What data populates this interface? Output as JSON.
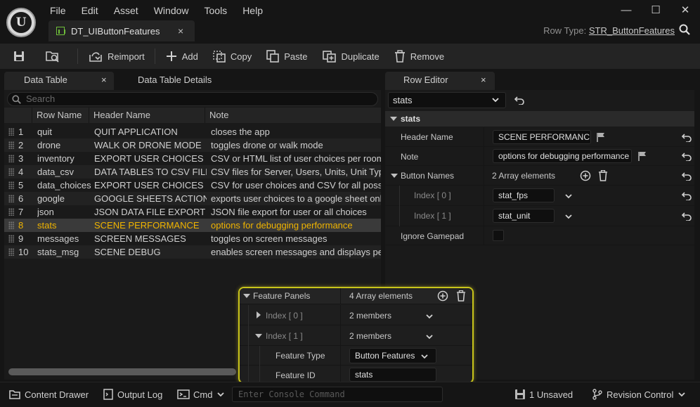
{
  "app": {
    "logo_letter": "U",
    "menu": [
      "File",
      "Edit",
      "Asset",
      "Window",
      "Tools",
      "Help"
    ],
    "window_controls": [
      "―",
      "☐",
      "✕"
    ],
    "document_tab": "DT_UIButtonFeatures",
    "document_tab_close": "×",
    "row_type_label": "Row Type:",
    "row_type_value": "STR_ButtonFeatures"
  },
  "toolbar": {
    "reimport": "Reimport",
    "add": "Add",
    "copy": "Copy",
    "paste": "Paste",
    "duplicate": "Duplicate",
    "remove": "Remove"
  },
  "left_panel": {
    "tab_data_table": "Data Table",
    "tab_close": "×",
    "tab_details": "Data Table Details",
    "search_placeholder": "Search",
    "columns": [
      "Row Name",
      "Header Name",
      "Note"
    ],
    "rows": [
      {
        "num": "1",
        "name": "quit",
        "header": "QUIT APPLICATION",
        "note": "closes the app"
      },
      {
        "num": "2",
        "name": "drone",
        "header": "WALK OR DRONE MODE",
        "note": "toggles drone or walk mode"
      },
      {
        "num": "3",
        "name": "inventory",
        "header": "EXPORT USER CHOICES",
        "note": "CSV or HTML list of user choices per room in"
      },
      {
        "num": "4",
        "name": "data_csv",
        "header": "DATA TABLES TO CSV FILES",
        "note": "CSV files for Server, Users, Units, Unit Types f"
      },
      {
        "num": "5",
        "name": "data_choices",
        "header": "EXPORT USER CHOICES",
        "note": "CSV for user choices and CSV for all possibl"
      },
      {
        "num": "6",
        "name": "google",
        "header": "GOOGLE SHEETS ACTIONS",
        "note": "exports user choices to a google sheet onlin"
      },
      {
        "num": "7",
        "name": "json",
        "header": "JSON DATA FILE EXPORT",
        "note": "JSON file export for user or all choices"
      },
      {
        "num": "8",
        "name": "stats",
        "header": "SCENE PERFORMANCE",
        "note": "options for debugging performance"
      },
      {
        "num": "9",
        "name": "messages",
        "header": "SCREEN MESSAGES",
        "note": "toggles on screen messages"
      },
      {
        "num": "10",
        "name": "stats_msg",
        "header": "SCENE DEBUG",
        "note": "enables screen messages and displays perfo"
      }
    ],
    "selected_row_index": 7
  },
  "row_editor": {
    "tab": "Row Editor",
    "tab_close": "×",
    "selected_row": "stats",
    "category": "stats",
    "header_name_label": "Header Name",
    "header_name_value": "SCENE PERFORMANCE",
    "note_label": "Note",
    "note_value": "options for debugging performance",
    "button_names_label": "Button Names",
    "button_names_count": "2 Array elements",
    "index0_label": "Index [ 0 ]",
    "index0_value": "stat_fps",
    "index1_label": "Index [ 1 ]",
    "index1_value": "stat_unit",
    "ignore_gamepad_label": "Ignore Gamepad",
    "ignore_gamepad_checked": false
  },
  "feature_panels": {
    "label": "Feature Panels",
    "count": "4 Array elements",
    "index0_label": "Index [ 0 ]",
    "index0_value": "2 members",
    "index1_label": "Index [ 1 ]",
    "index1_value": "2 members",
    "feature_type_label": "Feature Type",
    "feature_type_value": "Button Features",
    "feature_id_label": "Feature ID",
    "feature_id_value": "stats"
  },
  "status_bar": {
    "content_drawer": "Content Drawer",
    "output_log": "Output Log",
    "cmd": "Cmd",
    "console_placeholder": "Enter Console Command",
    "unsaved": "1 Unsaved",
    "revision_control": "Revision Control"
  },
  "colors": {
    "selected_row_text": "#f0b400",
    "highlight_border": "#c8c41a",
    "panel_bg": "#1a1a1a"
  }
}
